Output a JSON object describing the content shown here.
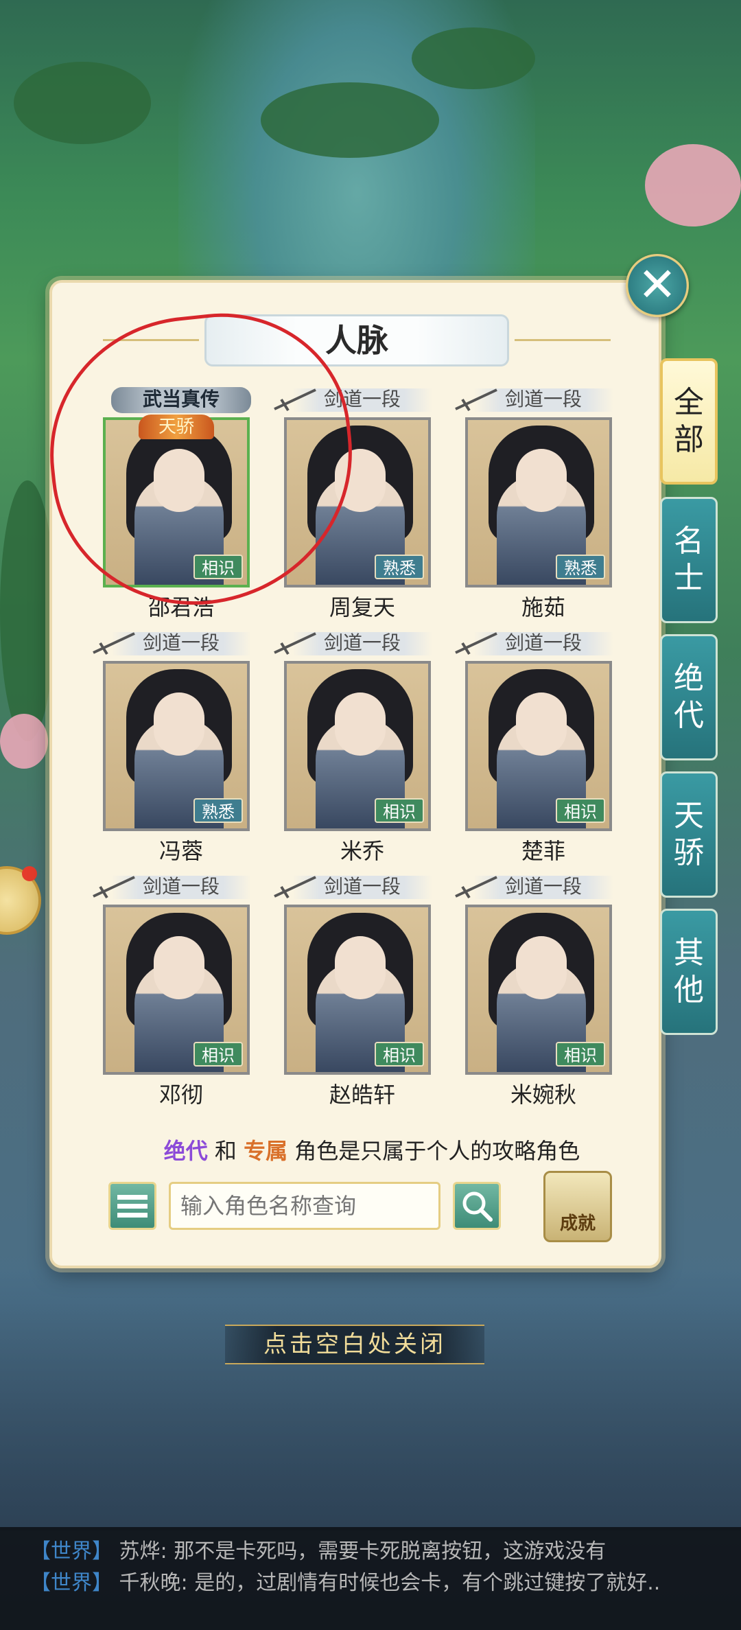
{
  "panel": {
    "title": "人脉",
    "close_icon": "close-icon"
  },
  "tabs": [
    {
      "label": "全部",
      "active": true
    },
    {
      "label": "名士",
      "active": false
    },
    {
      "label": "绝代",
      "active": false
    },
    {
      "label": "天骄",
      "active": false
    },
    {
      "label": "其他",
      "active": false
    }
  ],
  "characters": [
    {
      "rank": "武当真传",
      "name": "邵君浩",
      "relation": "相识",
      "tag": "天骄"
    },
    {
      "rank": "剑道一段",
      "name": "周复天",
      "relation": "熟悉"
    },
    {
      "rank": "剑道一段",
      "name": "施茹",
      "relation": "熟悉"
    },
    {
      "rank": "剑道一段",
      "name": "冯蓉",
      "relation": "熟悉"
    },
    {
      "rank": "剑道一段",
      "name": "米乔",
      "relation": "相识"
    },
    {
      "rank": "剑道一段",
      "name": "楚菲",
      "relation": "相识"
    },
    {
      "rank": "剑道一段",
      "name": "邓彻",
      "relation": "相识"
    },
    {
      "rank": "剑道一段",
      "name": "赵皓轩",
      "relation": "相识"
    },
    {
      "rank": "剑道一段",
      "name": "米婉秋",
      "relation": "相识"
    }
  ],
  "note": {
    "hl1": "绝代",
    "and": "和",
    "hl2": "专属",
    "rest": "角色是只属于个人的攻略角色"
  },
  "search": {
    "placeholder": "输入角色名称查询"
  },
  "achievement": {
    "label": "成就"
  },
  "close_hint": "点击空白处关闭",
  "chat": [
    {
      "channel": "【世界】",
      "name": "苏烨:",
      "text": "那不是卡死吗，需要卡死脱离按钮，这游戏没有"
    },
    {
      "channel": "【世界】",
      "name": "千秋晚:",
      "text": "是的，过剧情有时候也会卡，有个跳过键按了就好.."
    }
  ]
}
